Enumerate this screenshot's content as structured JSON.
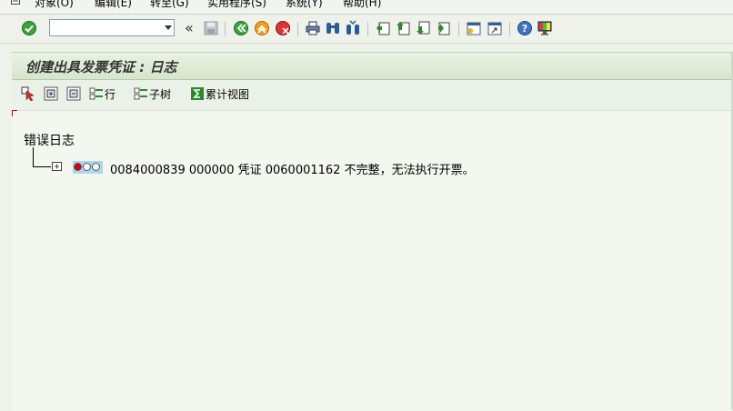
{
  "menu": {
    "items": [
      "对象(O)",
      "编辑(E)",
      "转至(G)",
      "实用程序(S)",
      "系统(Y)",
      "帮助(H)"
    ]
  },
  "toolbar": {
    "command_field_value": "",
    "icons": [
      "enter-icon",
      "command-field",
      "collapse-icon",
      "save-icon",
      "back-icon",
      "exit-icon",
      "cancel-icon",
      "print-icon",
      "find-icon",
      "find-next-icon",
      "first-page-icon",
      "previous-page-icon",
      "next-page-icon",
      "last-page-icon",
      "create-session-icon",
      "shortcut-icon",
      "help-icon",
      "layout-icon"
    ]
  },
  "title": "创建出具发票凭证 : 日志",
  "app_toolbar": {
    "buttons": [
      {
        "icon": "select-icon",
        "label": ""
      },
      {
        "icon": "expand-all-icon",
        "label": ""
      },
      {
        "icon": "collapse-all-icon",
        "label": ""
      },
      {
        "icon": "row-icon",
        "label": "行"
      },
      {
        "icon": "subtree-icon",
        "label": "子树"
      },
      {
        "icon": "sum-icon",
        "label": "累计视图"
      }
    ]
  },
  "log": {
    "root_label": "错误日志",
    "entries": [
      {
        "status": "red",
        "text": "0084000839 000000 凭证 0060001162 不完整，无法执行开票。"
      }
    ]
  },
  "colors": {
    "background": "#eef3ea",
    "title_bar": "#d7e5cc",
    "status_red": "#e00000",
    "highlight": "#a9d8f0"
  }
}
